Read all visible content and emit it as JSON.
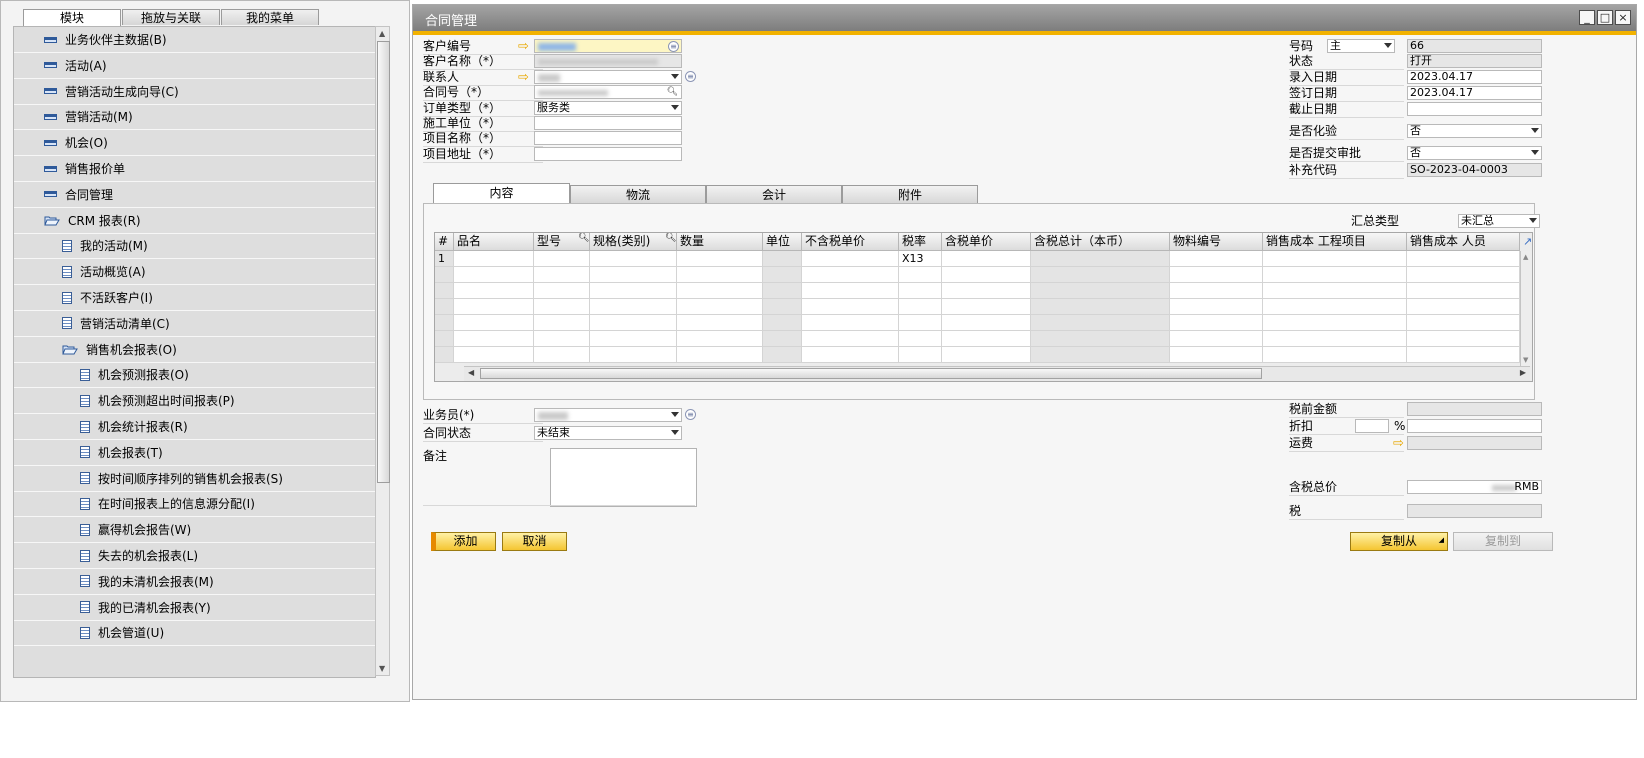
{
  "left_panel": {
    "tabs": [
      "模块",
      "拖放与关联",
      "我的菜单"
    ],
    "items": [
      {
        "label": "业务伙伴主数据(B)",
        "icon": "module-icon",
        "level": 0
      },
      {
        "label": "活动(A)",
        "icon": "module-icon",
        "level": 0
      },
      {
        "label": "营销活动生成向导(C)",
        "icon": "module-icon",
        "level": 0
      },
      {
        "label": "营销活动(M)",
        "icon": "module-icon",
        "level": 0
      },
      {
        "label": "机会(O)",
        "icon": "module-icon",
        "level": 0
      },
      {
        "label": "销售报价单",
        "icon": "module-icon",
        "level": 0
      },
      {
        "label": "合同管理",
        "icon": "module-icon",
        "level": 0
      },
      {
        "label": "CRM 报表(R)",
        "icon": "folder-open-icon",
        "level": 0
      },
      {
        "label": "我的活动(M)",
        "icon": "document-icon",
        "level": 1
      },
      {
        "label": "活动概览(A)",
        "icon": "document-icon",
        "level": 1
      },
      {
        "label": "不活跃客户(I)",
        "icon": "document-icon",
        "level": 1
      },
      {
        "label": "营销活动清单(C)",
        "icon": "document-icon",
        "level": 1
      },
      {
        "label": "销售机会报表(O)",
        "icon": "folder-open-icon",
        "level": 1
      },
      {
        "label": "机会预测报表(O)",
        "icon": "document-icon",
        "level": 2
      },
      {
        "label": "机会预测超出时间报表(P)",
        "icon": "document-icon",
        "level": 2
      },
      {
        "label": "机会统计报表(R)",
        "icon": "document-icon",
        "level": 2
      },
      {
        "label": "机会报表(T)",
        "icon": "document-icon",
        "level": 2
      },
      {
        "label": "按时间顺序排列的销售机会报表(S)",
        "icon": "document-icon",
        "level": 2
      },
      {
        "label": "在时间报表上的信息源分配(I)",
        "icon": "document-icon",
        "level": 2
      },
      {
        "label": "赢得机会报告(W)",
        "icon": "document-icon",
        "level": 2
      },
      {
        "label": "失去的机会报表(L)",
        "icon": "document-icon",
        "level": 2
      },
      {
        "label": "我的未清机会报表(M)",
        "icon": "document-icon",
        "level": 2
      },
      {
        "label": "我的已清机会报表(Y)",
        "icon": "document-icon",
        "level": 2
      },
      {
        "label": "机会管道(U)",
        "icon": "document-icon",
        "level": 2
      }
    ]
  },
  "window": {
    "title": "合同管理",
    "controls": [
      "_",
      "□",
      "×"
    ]
  },
  "header_left": {
    "customer_code_label": "客户编号",
    "customer_name_label": "客户名称（*）",
    "contact_label": "联系人",
    "contract_no_label": "合同号（*）",
    "order_type_label": "订单类型（*）",
    "order_type_value": "服务类",
    "construction_unit_label": "施工单位（*）",
    "project_name_label": "项目名称（*）",
    "project_address_label": "项目地址（*）"
  },
  "header_right": {
    "number_label": "号码",
    "number_series": "主",
    "number_value": "66",
    "status_label": "状态",
    "status_value": "打开",
    "entry_date_label": "录入日期",
    "entry_date_value": "2023.04.17",
    "sign_date_label": "签订日期",
    "sign_date_value": "2023.04.17",
    "due_date_label": "截止日期",
    "due_date_value": "",
    "chemical_test_label": "是否化验",
    "chemical_test_value": "否",
    "submit_approval_label": "是否提交审批",
    "submit_approval_value": "否",
    "supplement_code_label": "补充代码",
    "supplement_code_value": "SO-2023-04-0003"
  },
  "content_tabs": [
    "内容",
    "物流",
    "会计",
    "附件"
  ],
  "summary_type": {
    "label": "汇总类型",
    "value": "未汇总"
  },
  "grid": {
    "columns": [
      "#",
      "品名",
      "型号",
      "规格(类别)",
      "数量",
      "单位",
      "不含税单价",
      "税率",
      "含税单价",
      "含税总计（本币）",
      "物料编号",
      "销售成本 工程项目",
      "销售成本 人员"
    ],
    "rows": [
      {
        "num": "1",
        "tax_rate": "X13"
      }
    ],
    "empty_rows": 6
  },
  "footer_left": {
    "salesperson_label": "业务员(*)",
    "contract_status_label": "合同状态",
    "contract_status_value": "未结束",
    "remarks_label": "备注"
  },
  "footer_right": {
    "pretax_label": "税前金额",
    "discount_label": "折扣",
    "discount_unit": "%",
    "freight_label": "运费",
    "total_label": "含税总价",
    "currency": "RMB",
    "tax_label": "税"
  },
  "buttons": {
    "add": "添加",
    "cancel": "取消",
    "copy_from": "复制从",
    "copy_to": "复制到"
  }
}
